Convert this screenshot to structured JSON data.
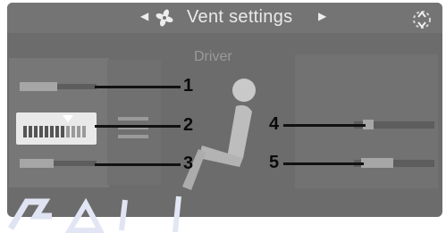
{
  "header": {
    "title": "Vent settings",
    "left_arrow_icon": "triangle-left-icon",
    "right_arrow_icon": "triangle-right-icon",
    "fan_icon": "fan-icon",
    "scroll_icon": "up-down-scroll-icon"
  },
  "section": {
    "label": "Driver"
  },
  "callouts": [
    "1",
    "2",
    "3",
    "4",
    "5"
  ],
  "colors": {
    "screen_bg": "#6c6c6c",
    "selected_control": "#e9e9e9",
    "callout": "#111111"
  }
}
